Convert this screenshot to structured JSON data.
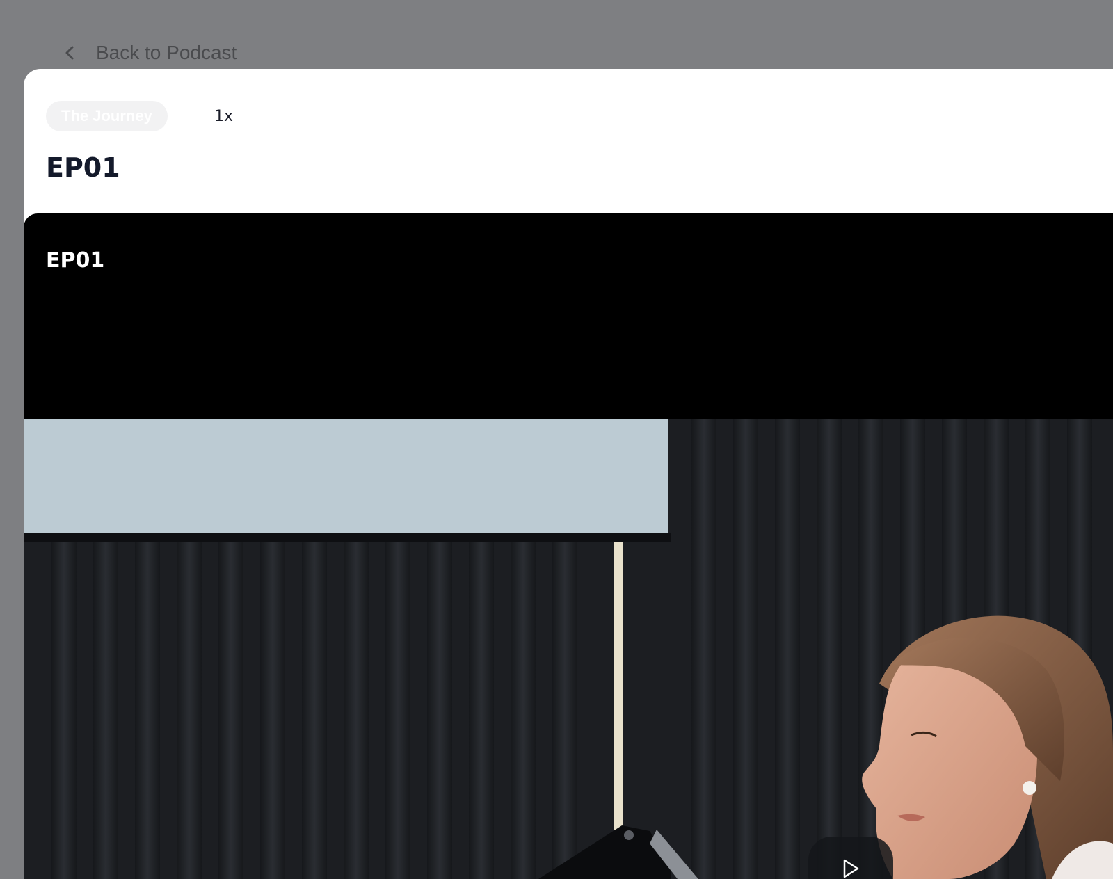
{
  "back_nav": {
    "label": "Back to Podcast",
    "icon": "arrow-left-icon"
  },
  "modal": {
    "series_chip": "The Journey",
    "playback_speed": "1x",
    "title": "EP01"
  },
  "player": {
    "video_title": "EP01",
    "play_icon": "play-icon"
  },
  "colors": {
    "backdrop": "#7e7f82",
    "modal_bg": "#ffffff",
    "title_text": "#141a2b",
    "player_bg": "#000000",
    "chip_bg": "#f2f2f3"
  }
}
